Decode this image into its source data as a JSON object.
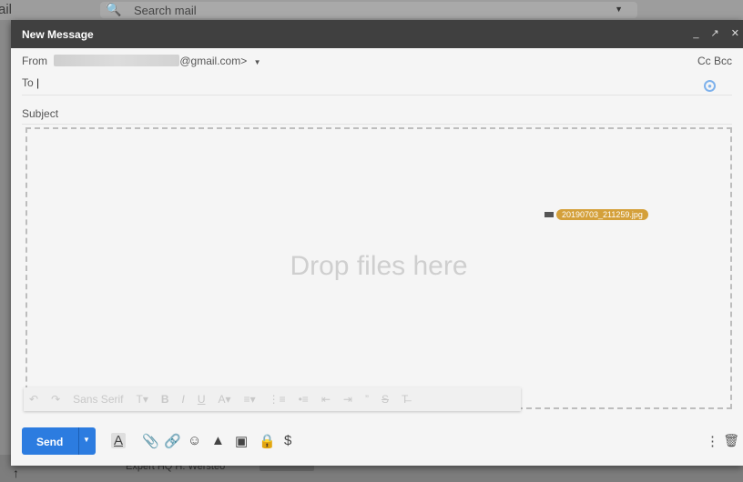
{
  "background": {
    "left_text": "ail",
    "search_placeholder": "Search mail",
    "bottom_text": "Expert HQ H: Wersteo"
  },
  "compose": {
    "title": "New Message",
    "window_controls": [
      "_",
      "↗",
      "✕"
    ],
    "from_label": "From",
    "from_address_suffix": "@gmail.com>",
    "cc_bcc": "Cc Bcc",
    "to_label": "To",
    "subject_label": "Subject",
    "drop_text": "Drop files here",
    "dragged_file": "20190703_211259.jpg",
    "format_toolbar": {
      "font": "Sans Serif",
      "items": [
        "undo-icon",
        "redo-icon",
        "font-select",
        "text-size-icon",
        "bold-icon",
        "italic-icon",
        "underline-icon",
        "text-color-icon",
        "align-icon",
        "numbered-list-icon",
        "bulleted-list-icon",
        "indent-less-icon",
        "indent-more-icon",
        "quote-icon",
        "strikethrough-icon",
        "remove-formatting-icon"
      ]
    },
    "send_label": "Send",
    "bottom_tools": [
      "formatting-icon",
      "attach-icon",
      "link-icon",
      "emoji-icon",
      "drive-icon",
      "photo-icon",
      "confidential-icon",
      "money-icon"
    ]
  }
}
